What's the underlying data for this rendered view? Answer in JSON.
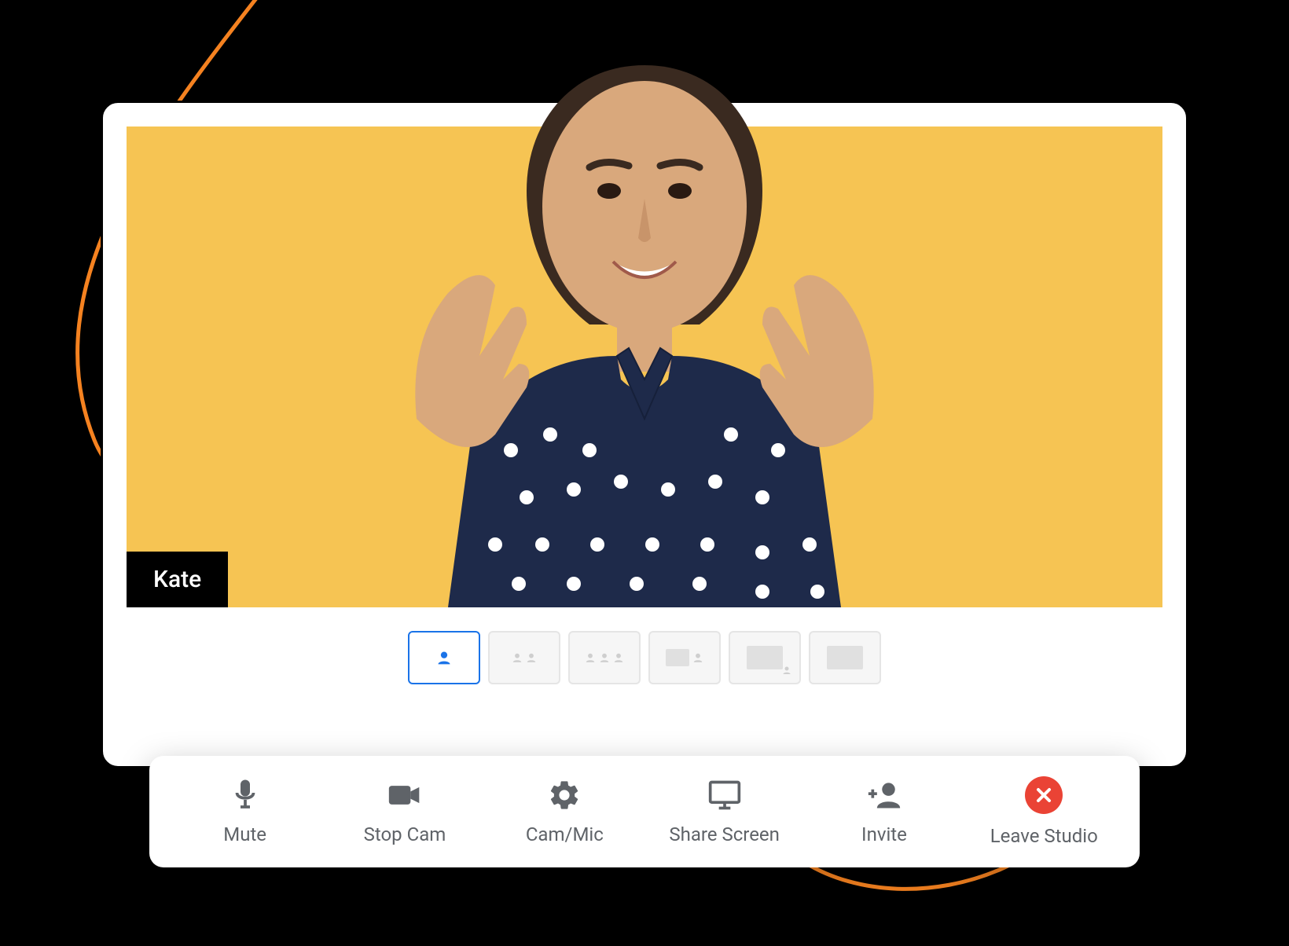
{
  "participant": {
    "name": "Kate"
  },
  "layouts": {
    "selected_index": 0,
    "types": [
      "single",
      "two-up",
      "three-up",
      "screen-plus-speaker",
      "screen-pip",
      "screen-only"
    ]
  },
  "toolbar": {
    "mute_label": "Mute",
    "stopcam_label": "Stop Cam",
    "cammic_label": "Cam/Mic",
    "sharescreen_label": "Share Screen",
    "invite_label": "Invite",
    "leave_label": "Leave Studio"
  },
  "icons": {
    "mute": "microphone-icon",
    "stopcam": "videocam-icon",
    "cammic": "gear-icon",
    "sharescreen": "monitor-icon",
    "invite": "add-person-icon",
    "leave": "close-icon"
  },
  "colors": {
    "accent": "#1a73e8",
    "video_bg": "#f6c453",
    "leave": "#ea4335",
    "icon": "#5f6368",
    "swirl": "#f58220"
  }
}
